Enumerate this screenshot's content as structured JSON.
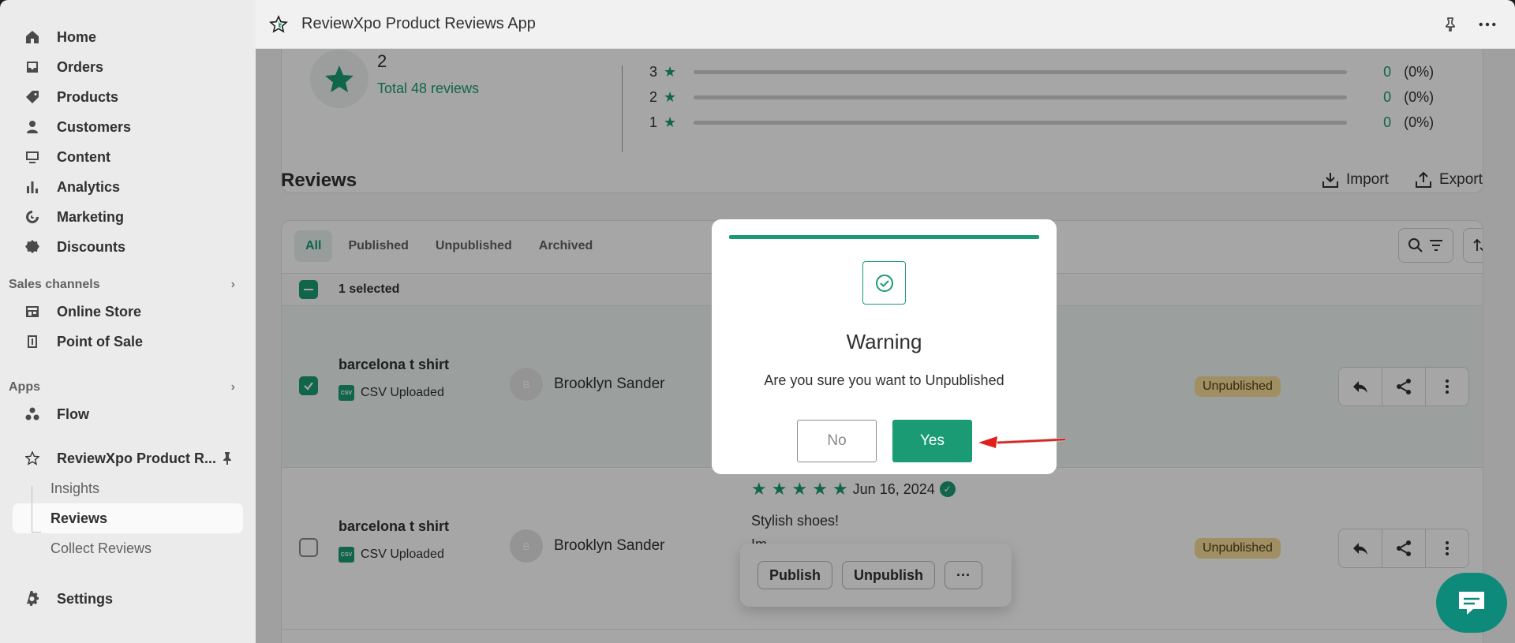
{
  "sidebar": {
    "nav": [
      {
        "label": "Home",
        "icon": "home-icon"
      },
      {
        "label": "Orders",
        "icon": "inbox-icon"
      },
      {
        "label": "Products",
        "icon": "tag-icon"
      },
      {
        "label": "Customers",
        "icon": "person-icon"
      },
      {
        "label": "Content",
        "icon": "image-icon"
      },
      {
        "label": "Analytics",
        "icon": "bar-chart-icon"
      },
      {
        "label": "Marketing",
        "icon": "target-icon"
      },
      {
        "label": "Discounts",
        "icon": "discount-icon"
      }
    ],
    "sales_channels_label": "Sales channels",
    "sales_channels": [
      {
        "label": "Online Store",
        "icon": "store-icon"
      },
      {
        "label": "Point of Sale",
        "icon": "pos-icon"
      }
    ],
    "apps_label": "Apps",
    "apps": [
      {
        "label": "Flow",
        "icon": "flow-icon"
      }
    ],
    "app_name": "ReviewXpo Product R...",
    "app_sub": [
      "Insights",
      "Reviews",
      "Collect Reviews"
    ],
    "settings": "Settings"
  },
  "topbar": {
    "title": "ReviewXpo Product Reviews App"
  },
  "summary": {
    "total": "Total 48 reviews",
    "partial_digit": "2",
    "ratings": [
      {
        "stars": "3",
        "count": "0",
        "pct": "(0%)"
      },
      {
        "stars": "2",
        "count": "0",
        "pct": "(0%)"
      },
      {
        "stars": "1",
        "count": "0",
        "pct": "(0%)"
      }
    ]
  },
  "reviews": {
    "title": "Reviews",
    "import": "Import",
    "export": "Export",
    "tabs": [
      "All",
      "Published",
      "Unpublished",
      "Archived"
    ],
    "selected": "1 selected",
    "rows": [
      {
        "product": "barcelona t shirt",
        "source": "CSV Uploaded",
        "initial": "B",
        "reviewer": "Brooklyn Sander",
        "status": "Unpublished"
      },
      {
        "product": "barcelona t shirt",
        "source": "CSV Uploaded",
        "initial": "B",
        "reviewer": "Brooklyn Sander",
        "status": "Unpublished",
        "date": "Jun 16, 2024",
        "text": "Stylish shoes!",
        "text2": "Im"
      }
    ]
  },
  "bulk": {
    "publish": "Publish",
    "unpublish": "Unpublish",
    "more": "···"
  },
  "modal": {
    "title": "Warning",
    "text": "Are you sure you want to Unpublished",
    "no": "No",
    "yes": "Yes"
  },
  "colors": {
    "accent": "#1a9b73",
    "badge": "#f8dc9a",
    "arrow": "#e0201a"
  }
}
